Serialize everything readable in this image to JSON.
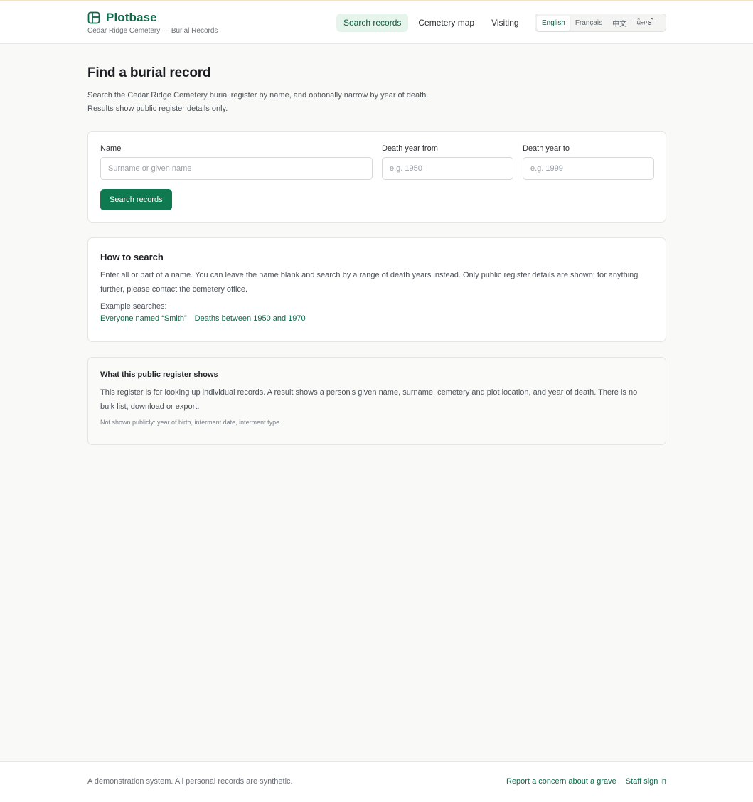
{
  "brand": {
    "name": "Plotbase",
    "subtitle": "Cedar Ridge Cemetery — Burial Records",
    "accent_color": "#0f7a50",
    "logo_icon": "book-map-icon"
  },
  "nav": {
    "items": [
      {
        "label": "Search records",
        "active": true
      },
      {
        "label": "Cemetery map",
        "active": false
      },
      {
        "label": "Visiting",
        "active": false
      }
    ]
  },
  "language": {
    "options": [
      "English",
      "Français",
      "中文",
      "ਪੰਜਾਬੀ"
    ],
    "selected": "English"
  },
  "page": {
    "title": "Find a burial record",
    "intro_line1": "Search the Cedar Ridge Cemetery burial register by name, and optionally narrow by year of death.",
    "intro_line2": "Results show public register details only."
  },
  "search_form": {
    "name_label": "Name",
    "name_placeholder": "Surname or given name",
    "from_label": "Death year from",
    "from_placeholder": "e.g. 1950",
    "to_label": "Death year to",
    "to_placeholder": "e.g. 1999",
    "submit_label": "Search records"
  },
  "how_to": {
    "heading": "How to search",
    "body": "Enter all or part of a name. You can leave the name blank and search by a range of death years instead. Only public register details are shown; for anything further, please contact the cemetery office.",
    "examples_label": "Example searches:",
    "examples": [
      "Everyone named “Smith”",
      "Deaths between 1950 and 1970"
    ]
  },
  "register_info": {
    "heading": "What this public register shows",
    "body": "This register is for looking up individual records. A result shows a person's given name, surname, cemetery and plot location, and year of death. There is no bulk list, download or export.",
    "note": "Not shown publicly: year of birth, interment date, interment type."
  },
  "footer": {
    "note": "A demonstration system. All personal records are synthetic.",
    "links": [
      "Report a concern about a grave",
      "Staff sign in"
    ]
  }
}
